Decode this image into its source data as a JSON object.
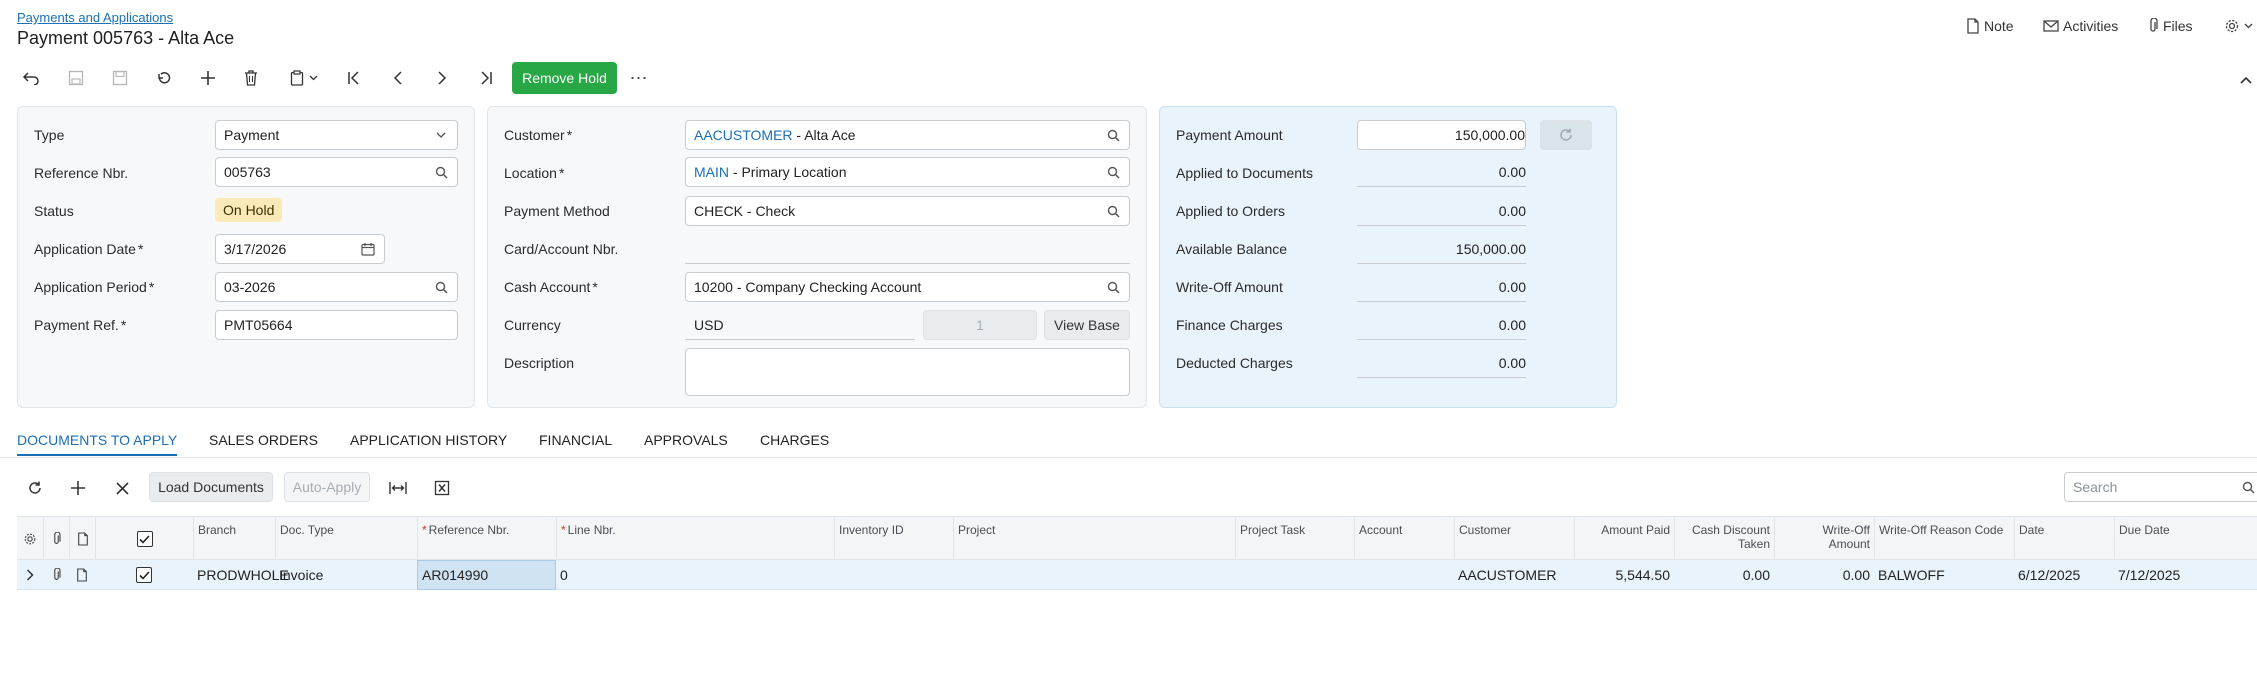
{
  "header": {
    "breadcrumb": "Payments and Applications",
    "title": "Payment 005763 - Alta Ace",
    "actions": {
      "note": "Note",
      "activities": "Activities",
      "files": "Files"
    }
  },
  "toolbar": {
    "remove_hold": "Remove Hold",
    "more": "⋯"
  },
  "summary": {
    "type_label": "Type",
    "type_value": "Payment",
    "ref_label": "Reference Nbr.",
    "ref_value": "005763",
    "status_label": "Status",
    "status_value": "On Hold",
    "appdate_label": "Application Date",
    "appdate_value": "3/17/2026",
    "appperiod_label": "Application Period",
    "appperiod_value": "03-2026",
    "payref_label": "Payment Ref.",
    "payref_value": "PMT05664",
    "req_mark": "*"
  },
  "customer_panel": {
    "customer_label": "Customer",
    "customer_code": "AACUSTOMER",
    "customer_name": " - Alta Ace",
    "location_label": "Location",
    "location_code": "MAIN",
    "location_name": " - Primary Location",
    "paymethod_label": "Payment Method",
    "paymethod_value": "CHECK - Check",
    "card_label": "Card/Account Nbr.",
    "cash_label": "Cash Account",
    "cash_value": "10200 - Company Checking Account",
    "currency_label": "Currency",
    "currency_value": "USD",
    "rate_value": "1",
    "view_base": "View Base",
    "description_label": "Description"
  },
  "amounts": {
    "payment_amount_label": "Payment Amount",
    "payment_amount": "150,000.00",
    "applied_docs_label": "Applied to Documents",
    "applied_docs": "0.00",
    "applied_orders_label": "Applied to Orders",
    "applied_orders": "0.00",
    "available_label": "Available Balance",
    "available": "150,000.00",
    "writeoff_label": "Write-Off Amount",
    "writeoff": "0.00",
    "finance_label": "Finance Charges",
    "finance": "0.00",
    "deducted_label": "Deducted Charges",
    "deducted": "0.00"
  },
  "tabs": [
    "DOCUMENTS TO APPLY",
    "SALES ORDERS",
    "APPLICATION HISTORY",
    "FINANCIAL",
    "APPROVALS",
    "CHARGES"
  ],
  "grid_toolbar": {
    "load_documents": "Load Documents",
    "auto_apply": "Auto-Apply",
    "search_placeholder": "Search"
  },
  "grid": {
    "columns": {
      "branch": "Branch",
      "doc_type": "Doc. Type",
      "ref_nbr": "Reference Nbr.",
      "line_nbr": "Line Nbr.",
      "inventory_id": "Inventory ID",
      "project": "Project",
      "project_task": "Project Task",
      "account": "Account",
      "customer": "Customer",
      "amount_paid": "Amount Paid",
      "cash_discount": "Cash Discount Taken",
      "writeoff_amount": "Write-Off Amount",
      "writeoff_reason": "Write-Off Reason Code",
      "date": "Date",
      "due_date": "Due Date"
    },
    "rows": [
      {
        "branch": "PRODWHOLE",
        "doc_type": "Invoice",
        "ref_nbr": "AR014990",
        "line_nbr": "0",
        "customer": "AACUSTOMER",
        "amount_paid": "5,544.50",
        "cash_discount": "0.00",
        "writeoff_amount": "0.00",
        "writeoff_reason": "BALWOFF",
        "date": "6/12/2025",
        "due_date": "7/12/2025"
      }
    ]
  },
  "colors": {
    "accent": "#1a6fb5",
    "remove_hold_bg": "#27a745",
    "status_badge_bg": "#fbe9b7",
    "amount_panel_bg": "#e8f3fb"
  }
}
